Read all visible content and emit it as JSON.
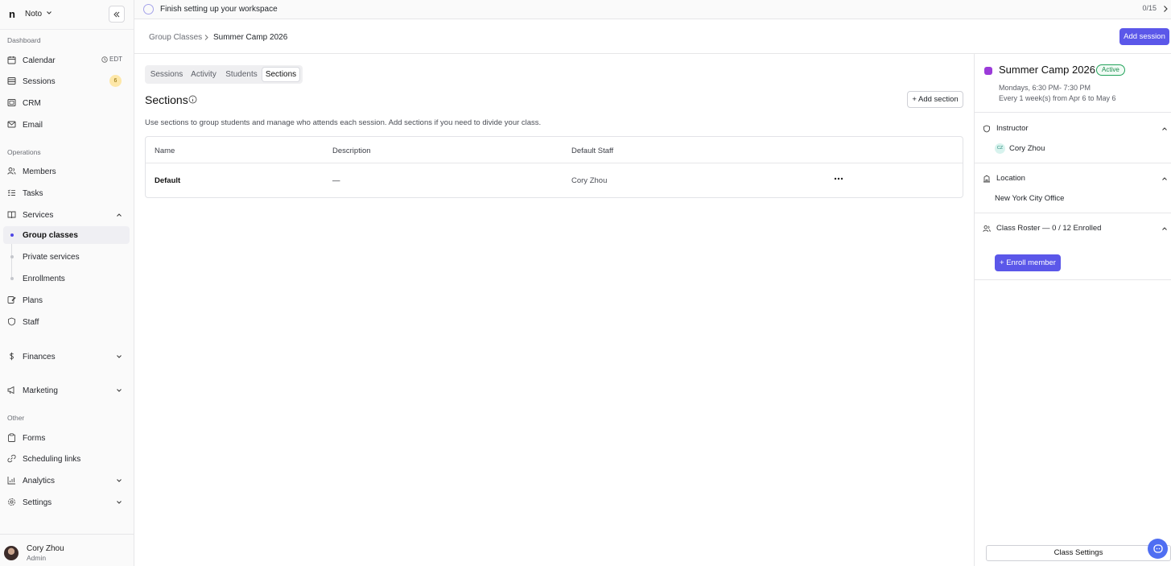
{
  "workspace": {
    "logo": "n",
    "name": "Noto"
  },
  "sidebar": {
    "sections": {
      "dashboard": "Dashboard",
      "operations": "Operations",
      "other": "Other"
    },
    "calendar": {
      "label": "Calendar",
      "tz": "EDT"
    },
    "sessions": {
      "label": "Sessions",
      "badge": "6"
    },
    "crm": "CRM",
    "email": "Email",
    "members": "Members",
    "tasks": "Tasks",
    "services": "Services",
    "group_classes": "Group classes",
    "private_services": "Private services",
    "enrollments": "Enrollments",
    "plans": "Plans",
    "staff": "Staff",
    "finances": "Finances",
    "marketing": "Marketing",
    "forms": "Forms",
    "scheduling_links": "Scheduling links",
    "analytics": "Analytics",
    "settings": "Settings"
  },
  "user": {
    "name": "Cory Zhou",
    "role": "Admin"
  },
  "banner": {
    "text": "Finish setting up your workspace",
    "progress": "0/15"
  },
  "breadcrumb": {
    "parent": "Group Classes",
    "current": "Summer Camp 2026"
  },
  "header": {
    "add_session": "Add session"
  },
  "tabs": [
    "Sessions",
    "Activity",
    "Students",
    "Sections"
  ],
  "active_tab": "Sections",
  "sections_panel": {
    "title": "Sections",
    "add_button": "+ Add section",
    "description": "Use sections to group students and manage who attends each session. Add sections if you need to divide your class.",
    "columns": [
      "Name",
      "Description",
      "Default Staff"
    ],
    "rows": [
      {
        "name": "Default",
        "description": "—",
        "staff": "Cory Zhou"
      }
    ]
  },
  "class_panel": {
    "title": "Summer Camp 2026",
    "status": "Active",
    "color": "#9b3bd9",
    "schedule_line1": "Mondays, 6:30 PM- 7:30 PM",
    "schedule_line2": "Every 1 week(s) from Apr 6 to May 6",
    "instructor_label": "Instructor",
    "instructor_initials": "CZ",
    "instructor_name": "Cory Zhou",
    "location_label": "Location",
    "location_name": "New York City Office",
    "roster_label": "Class Roster — 0 / 12 Enrolled",
    "enroll_button": "+ Enroll member",
    "settings_button": "Class Settings"
  }
}
